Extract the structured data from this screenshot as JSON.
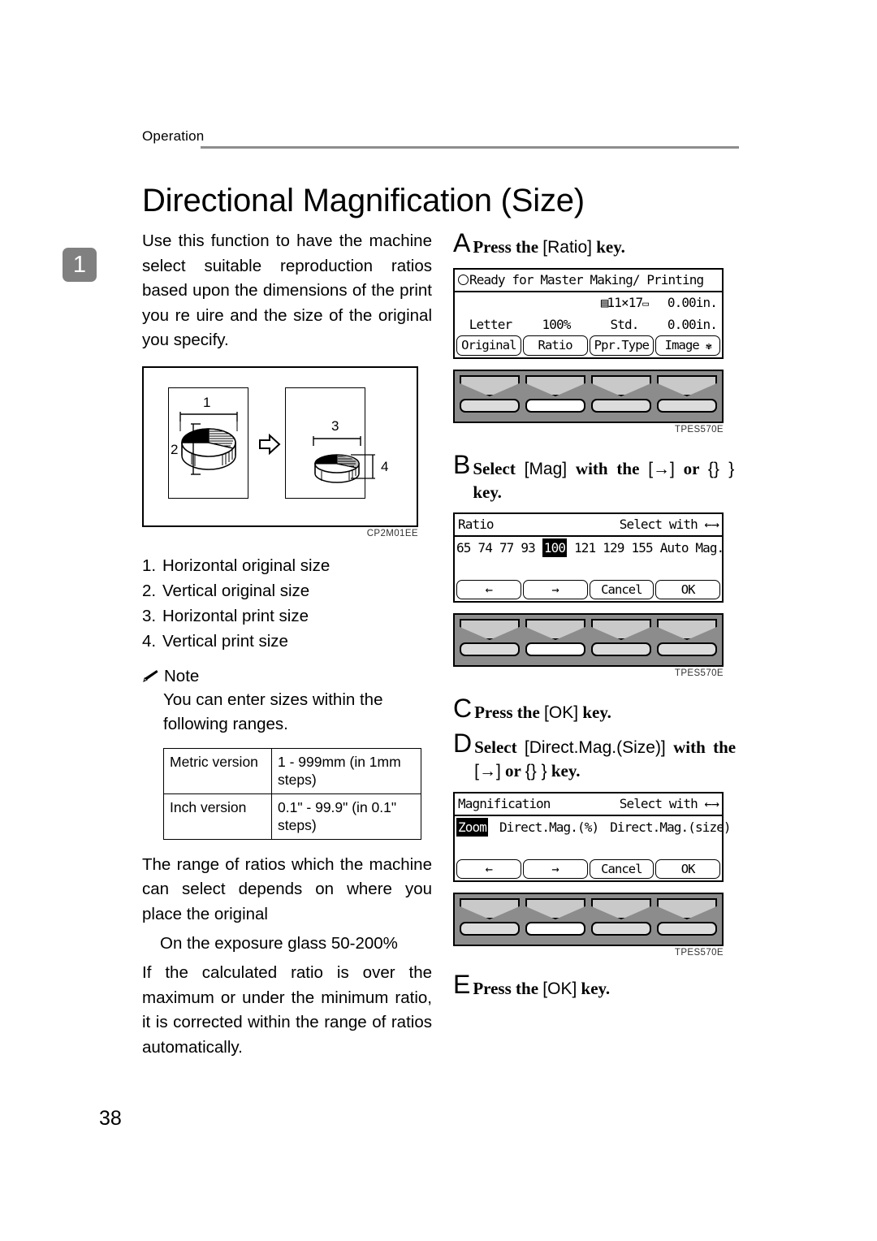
{
  "running_head": "Operation",
  "page_number": "38",
  "chapter_tab": "1",
  "title": "Directional Magnification (Size)",
  "left": {
    "intro": "Use this function to have the machine select suitable reproduction ratios based upon the dimensions of the print you re uire and the size of the original you specify.",
    "figure": {
      "caption": "CP2M01EE",
      "callouts": [
        "1",
        "2",
        "3",
        "4"
      ]
    },
    "legend": [
      {
        "n": "1.",
        "text": "Horizontal original size"
      },
      {
        "n": "2.",
        "text": "Vertical original size"
      },
      {
        "n": "3.",
        "text": "Horizontal print size"
      },
      {
        "n": "4.",
        "text": "Vertical print size"
      }
    ],
    "note_label": "Note",
    "note_body": "You can enter sizes within the following ranges.",
    "range_table": {
      "rows": [
        {
          "version": "Metric version",
          "range": "1 - 999mm (in 1mm steps)"
        },
        {
          "version": "Inch version",
          "range": "0.1\" - 99.9\" (in 0.1\" steps)"
        }
      ]
    },
    "para_range": "The range of ratios which the machine can select depends on where you place the original",
    "para_glass": "On the exposure glass  50-200%",
    "para_corrected": "If the calculated ratio is over the maximum or under the minimum ratio, it is corrected within the range of ratios automatically."
  },
  "steps": [
    {
      "letter": "A",
      "text_pre": "Press the ",
      "text_key": "[Ratio]",
      "text_post": " key."
    },
    {
      "letter": "B",
      "text_pre": "Select ",
      "text_key": "[Mag]",
      "text_mid": " with the ",
      "text_key2": "[→]",
      "text_mid2": " or ",
      "text_key3": "{} }",
      "text_post": " key."
    },
    {
      "letter": "C",
      "text_pre": "Press the ",
      "text_key": "[OK]",
      "text_post": " key."
    },
    {
      "letter": "D",
      "text_pre": "Select ",
      "text_key": "[Direct.Mag.(Size)]",
      "text_mid": " with the ",
      "text_key2": "[→]",
      "text_mid2": " or ",
      "text_key3": "{} }",
      "text_post": " key."
    },
    {
      "letter": "E",
      "text_pre": "Press the ",
      "text_key": "[OK]",
      "text_post": " key."
    }
  ],
  "screen_a": {
    "status": "Ready for Master Making/ Printing",
    "row1": {
      "c1": "",
      "c2": "",
      "c3": "11×17",
      "c4": "0.00in."
    },
    "row2": {
      "c1": "Letter",
      "c2": "100%",
      "c3": "Std.",
      "c4": "0.00in."
    },
    "softkeys": [
      "Original",
      "Ratio",
      "Ppr.Type",
      "Image"
    ],
    "caption": "TPES570E"
  },
  "screen_b": {
    "header_left": "Ratio",
    "header_right": "Select with ←→",
    "ratios": [
      "65",
      "74",
      "77",
      "93",
      "100",
      "121",
      "129",
      "155",
      "Auto Mag."
    ],
    "selected_ratio": "100",
    "softkeys": [
      "←",
      "→",
      "Cancel",
      "OK"
    ],
    "caption": "TPES570E"
  },
  "screen_d": {
    "header_left": "Magnification",
    "header_right": "Select with ←→",
    "options": [
      "Zoom",
      "Direct.Mag.(%)",
      "Direct.Mag.(size)"
    ],
    "selected_option": "Zoom",
    "softkeys": [
      "←",
      "→",
      "Cancel",
      "OK"
    ],
    "caption": "TPES570E"
  },
  "keystrip": {
    "active_index": 1
  }
}
